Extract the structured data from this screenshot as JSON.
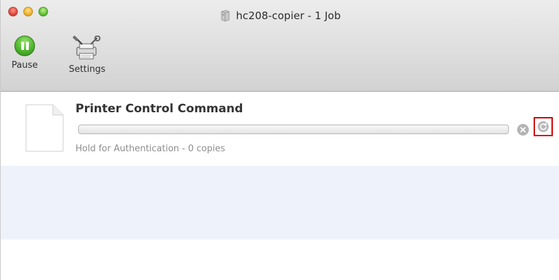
{
  "window": {
    "title": "hc208-copier - 1 Job",
    "title_icon": "printer-icon"
  },
  "toolbar": {
    "pause_label": "Pause",
    "settings_label": "Settings"
  },
  "jobs": [
    {
      "name": "Printer Control Command",
      "status": "Hold for Authentication - 0 copies",
      "progress": 0
    }
  ],
  "colors": {
    "pause_green": "#4fb52f",
    "highlight_red": "#d40000",
    "alt_row": "#eef3fb"
  }
}
